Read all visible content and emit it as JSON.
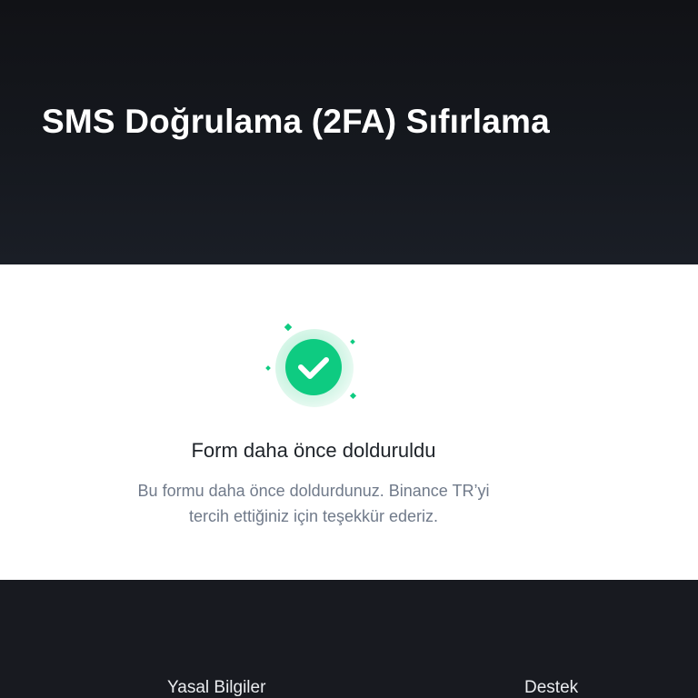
{
  "header": {
    "title": "SMS Doğrulama (2FA) Sıfırlama"
  },
  "status": {
    "icon": "check-circle-icon",
    "title": "Form daha önce dolduruldu",
    "description": "Bu formu daha önce doldurdunuz. Binance TR’yi tercih ettiğiniz için teşekkür ederiz."
  },
  "footer": {
    "links": [
      {
        "label": "Yasal Bilgiler"
      },
      {
        "label": "Destek"
      }
    ]
  },
  "colors": {
    "header_bg": "#111216",
    "footer_bg": "#181a20",
    "success_green": "#0ecb81",
    "title_text": "#1e2329",
    "muted_text": "#707a8a"
  }
}
